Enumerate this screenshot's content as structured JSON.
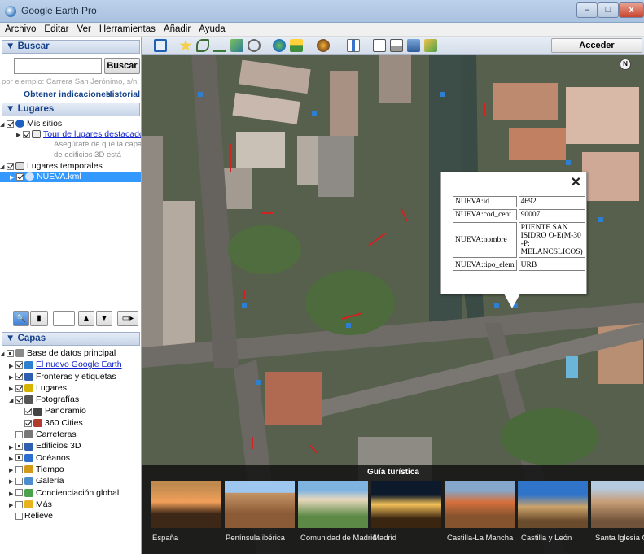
{
  "window": {
    "title": "Google Earth Pro",
    "min": "–",
    "max": "□",
    "close": "x"
  },
  "menu": [
    "Archivo",
    "Editar",
    "Ver",
    "Herramientas",
    "Añadir",
    "Ayuda"
  ],
  "search": {
    "header": "▼ Buscar",
    "placeholder": "",
    "button": "Buscar",
    "hint": "por ejemplo: Carrera San Jerónimo, s/n, Madrid",
    "directions_link": "Obtener indicaciones",
    "history_link": "Historial"
  },
  "places": {
    "header": "▼ Lugares",
    "my_places": "Mis sitios",
    "tour_link": "Tour de lugares destacados",
    "tour_note_1": "Asegúrate de que la capa",
    "tour_note_2": "de edificios 3D está",
    "temp_places": "Lugares temporales",
    "kml": "NUEVA.kml"
  },
  "layers": {
    "header": "▼ Capas",
    "items": [
      {
        "label": "Base de datos principal",
        "level": 0,
        "link": false
      },
      {
        "label": "El nuevo Google Earth",
        "level": 1,
        "link": true
      },
      {
        "label": "Fronteras y etiquetas",
        "level": 1,
        "link": false
      },
      {
        "label": "Lugares",
        "level": 1,
        "link": false
      },
      {
        "label": "Fotografías",
        "level": 1,
        "link": false
      },
      {
        "label": "Panoramio",
        "level": 2,
        "link": false
      },
      {
        "label": "360 Cities",
        "level": 2,
        "link": false
      },
      {
        "label": "Carreteras",
        "level": 1,
        "link": false
      },
      {
        "label": "Edificios 3D",
        "level": 1,
        "link": false
      },
      {
        "label": "Océanos",
        "level": 1,
        "link": false
      },
      {
        "label": "Tiempo",
        "level": 1,
        "link": false
      },
      {
        "label": "Galería",
        "level": 1,
        "link": false
      },
      {
        "label": "Concienciación global",
        "level": 1,
        "link": false
      },
      {
        "label": "Más",
        "level": 1,
        "link": false
      },
      {
        "label": "Relieve",
        "level": 1,
        "link": false
      }
    ]
  },
  "toolbar": {
    "acceder": "Acceder"
  },
  "map": {
    "north": "N"
  },
  "balloon": {
    "close": "✕",
    "rows": [
      {
        "key": "NUEVA:id",
        "value": "4692"
      },
      {
        "key": "NUEVA:cod_cent",
        "value": "90007"
      },
      {
        "key": "NUEVA:nombre",
        "value": "PUENTE SAN ISIDRO O-E(M-30 -P: MELANCSLICOS)"
      },
      {
        "key": "NUEVA:tipo_elem",
        "value": "URB"
      }
    ]
  },
  "tour": {
    "title": "Guía turística",
    "cards": [
      "España",
      "Península ibérica",
      "Comunidad de Madrid",
      "Madrid",
      "Castilla-La Mancha",
      "Castilla y León",
      "Santa Iglesia Ca"
    ]
  }
}
